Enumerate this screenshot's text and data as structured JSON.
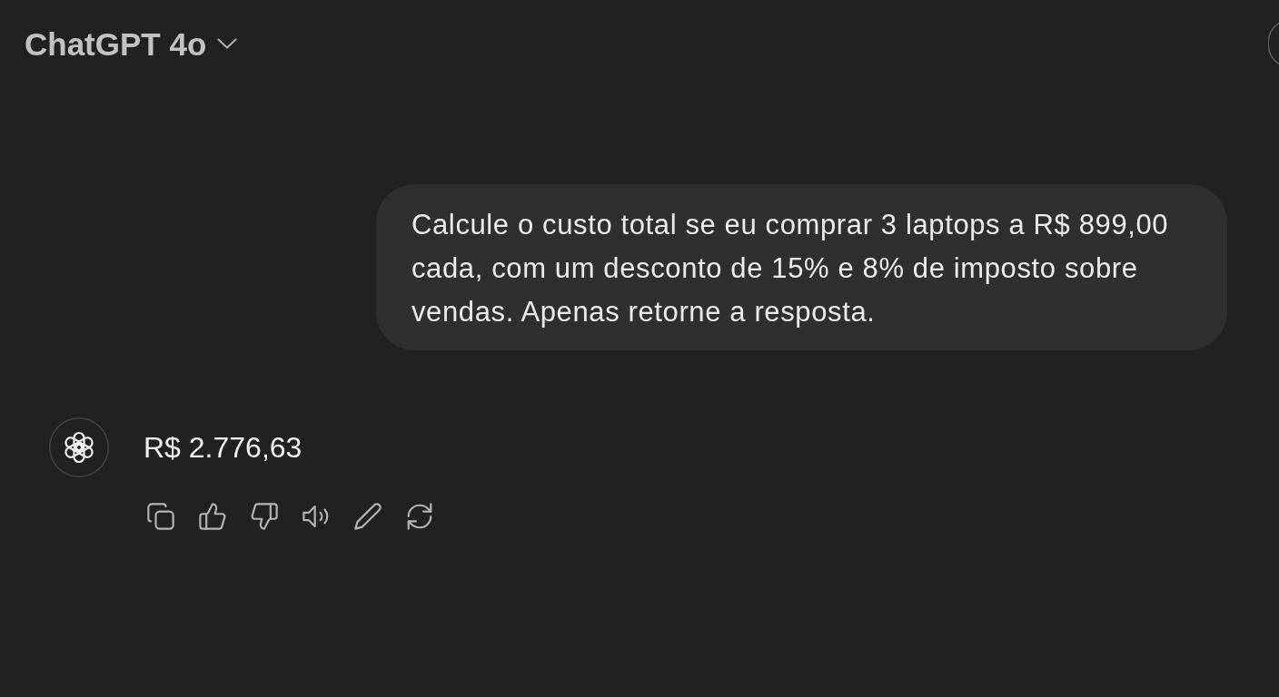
{
  "header": {
    "title": "ChatGPT 4o"
  },
  "messages": [
    {
      "kind": "user",
      "text": "Calcule o custo total se eu comprar 3 laptops a R$ 899,00 cada, com um desconto de 15% e 8% de imposto sobre vendas. Apenas retorne a resposta."
    },
    {
      "kind": "assistant",
      "text": "R$ 2.776,63"
    }
  ]
}
